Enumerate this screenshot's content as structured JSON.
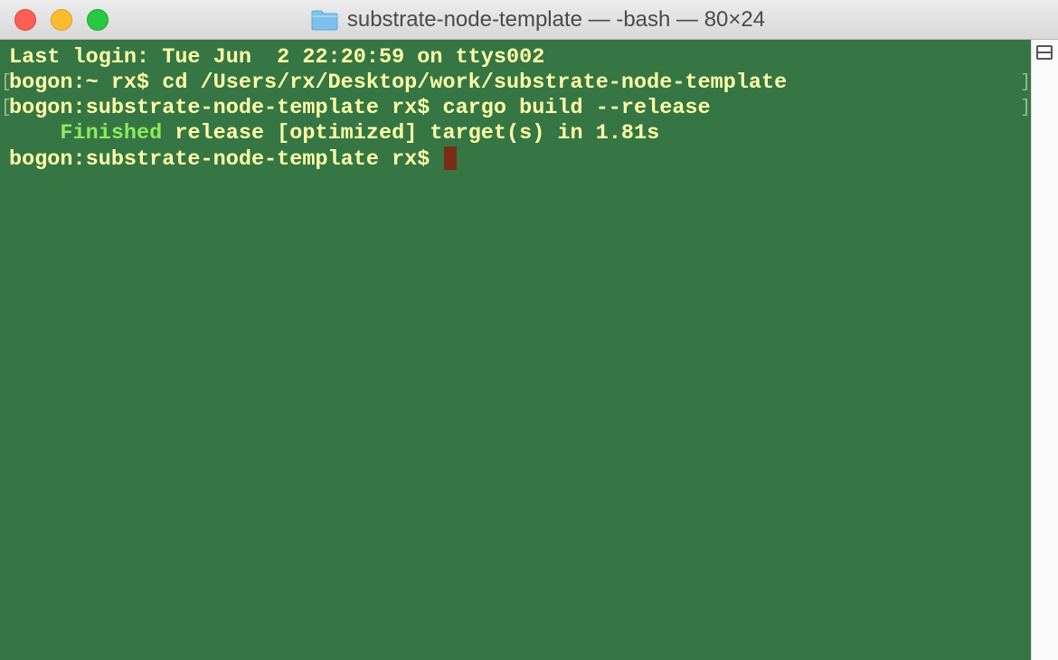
{
  "window": {
    "title": "substrate-node-template — -bash — 80×24",
    "icon": "folder-icon"
  },
  "terminal": {
    "background_color": "#357644",
    "text_color": "#ffffa8",
    "accent_color": "#8fea5c",
    "cursor_color": "#7b2d14",
    "lines": {
      "l1": "Last login: Tue Jun  2 22:20:59 on ttys002",
      "l2": "bogon:~ rx$ cd /Users/rx/Desktop/work/substrate-node-template",
      "l3": "bogon:substrate-node-template rx$ cargo build --release",
      "l4_indent": "    ",
      "l4_status": "Finished",
      "l4_rest": " release [optimized] target(s) in 1.81s",
      "l5_prompt": "bogon:substrate-node-template rx$ "
    },
    "marks": {
      "left": "[",
      "right": "]"
    }
  }
}
